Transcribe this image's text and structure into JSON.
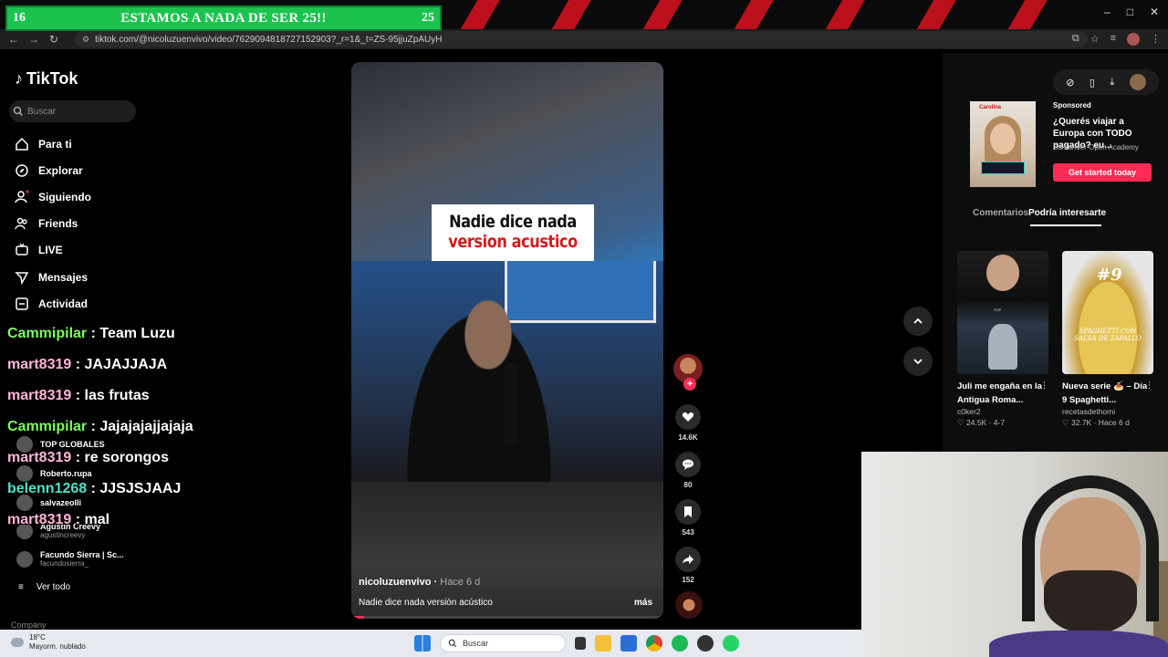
{
  "overlay_banner": {
    "left_number": "16",
    "title": "ESTAMOS A NADA DE SER 25!!",
    "right_number": "25"
  },
  "browser": {
    "url": "tiktok.com/@nicoluzuenvivo/video/7629094818727152903?_r=1&_t=ZS-95jjuZpAUyH"
  },
  "sidebar": {
    "logo": "TikTok",
    "search_placeholder": "Buscar",
    "nav": [
      {
        "label": "Para ti",
        "icon": "home-icon"
      },
      {
        "label": "Explorar",
        "icon": "compass-icon"
      },
      {
        "label": "Siguiendo",
        "icon": "following-icon"
      },
      {
        "label": "Friends",
        "icon": "friends-icon"
      },
      {
        "label": "LIVE",
        "icon": "live-icon"
      },
      {
        "label": "Mensajes",
        "icon": "send-icon"
      },
      {
        "label": "Actividad",
        "icon": "activity-icon"
      }
    ],
    "following": [
      {
        "name": "TOP GLOBALES",
        "handle": ""
      },
      {
        "name": "Roberto.rupa",
        "handle": ""
      },
      {
        "name": "salvazeolli",
        "handle": ""
      },
      {
        "name": "Agustin Creevy",
        "handle": "agustincreevy"
      },
      {
        "name": "Facundo Sierra | Sc...",
        "handle": "facundosierra_"
      }
    ],
    "see_all": "Ver todo",
    "company": "Company"
  },
  "chat": [
    {
      "user": "Cammipilar",
      "user_color": "#7CFC5A",
      "msg": "Team Luzu"
    },
    {
      "user": "mart8319",
      "user_color": "#FFB6D9",
      "msg": "JAJAJJAJA"
    },
    {
      "user": "mart8319",
      "user_color": "#FFB6D9",
      "msg": "las frutas"
    },
    {
      "user": "Cammipilar",
      "user_color": "#7CFC5A",
      "msg": "Jajajajajjajaja"
    },
    {
      "user": "mart8319",
      "user_color": "#FFB6D9",
      "msg": "re sorongos"
    },
    {
      "user": "belenn1268",
      "user_color": "#4FE3C6",
      "msg": "JJSJSJAAJ"
    },
    {
      "user": "mart8319",
      "user_color": "#FFB6D9",
      "msg": "mal"
    }
  ],
  "video": {
    "caption_line1": "Nadie dice nada",
    "caption_line2": "version acustico",
    "author": "nicoluzuenvivo",
    "time": "Hace 6 d",
    "description": "Nadie dice nada versión acústico",
    "more": "más"
  },
  "actions": {
    "likes": "14.6K",
    "comments": "80",
    "saves": "543",
    "shares": "152"
  },
  "right_panel": {
    "ad": {
      "sponsored": "Sponsored",
      "headline": "¿Querés viajar a Europa con TODO pagado? eu...",
      "advertiser": "Santander Open Academy",
      "cta": "Get started today",
      "brand": "Carolina"
    },
    "tabs": [
      "Comentarios",
      "Podría interesarte"
    ],
    "recommendations": [
      {
        "title": "Juli me engaña en la Antigua Roma...",
        "creator": "c0ker2",
        "likes": "24.5K",
        "extra": "4-7"
      },
      {
        "title": "Nueva serie 🍝 – Día 9 Spaghetti...",
        "creator": "recetasdethomi",
        "likes": "32.7K",
        "extra": "Hace 6 d"
      }
    ],
    "pasta_number": "#9",
    "pasta_caption": "SPAGHETTI CON SALSA DE ZAPALLO"
  },
  "taskbar": {
    "temp": "18°C",
    "weather": "Mayorm. nublado",
    "search_placeholder": "Buscar"
  }
}
